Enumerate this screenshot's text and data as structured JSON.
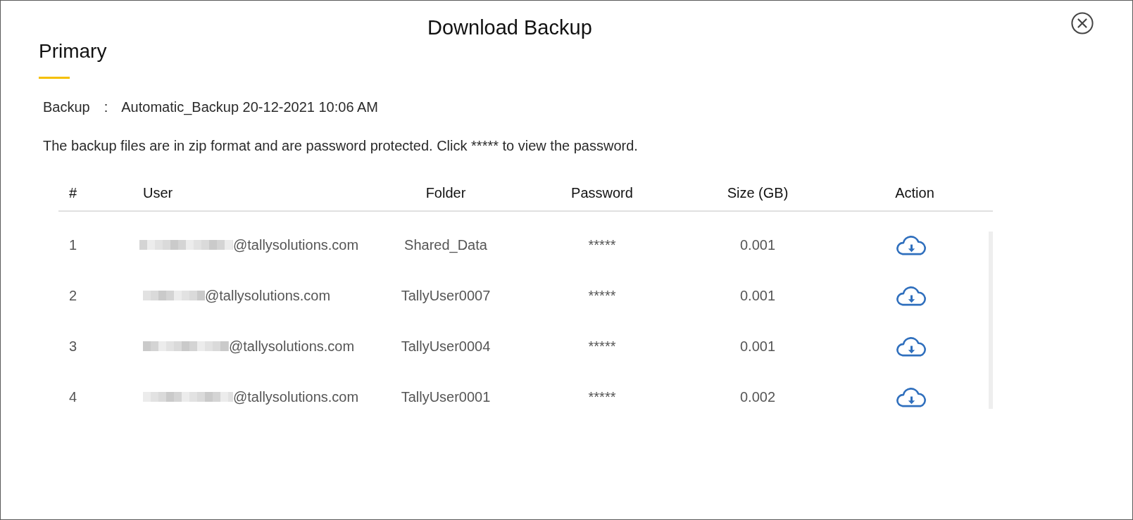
{
  "dialog": {
    "title": "Download Backup",
    "section_title": "Primary",
    "backup": {
      "label": "Backup",
      "separator": ":",
      "value": "Automatic_Backup 20-12-2021 10:06 AM"
    },
    "note": "The backup files are in zip format and are password protected. Click ***** to view the password.",
    "table": {
      "columns": [
        "#",
        "User",
        "Folder",
        "Password",
        "Size (GB)",
        "Action"
      ],
      "rows": [
        {
          "index": "1",
          "user": "@tallysolutions.com",
          "folder": "Shared_Data",
          "password": "*****",
          "size": "0.001"
        },
        {
          "index": "2",
          "user": "@tallysolutions.com",
          "folder": "TallyUser0007",
          "password": "*****",
          "size": "0.001"
        },
        {
          "index": "3",
          "user": "@tallysolutions.com",
          "folder": "TallyUser0004",
          "password": "*****",
          "size": "0.001"
        },
        {
          "index": "4",
          "user": "@tallysolutions.com",
          "folder": "TallyUser0001",
          "password": "*****",
          "size": "0.002"
        }
      ]
    }
  }
}
